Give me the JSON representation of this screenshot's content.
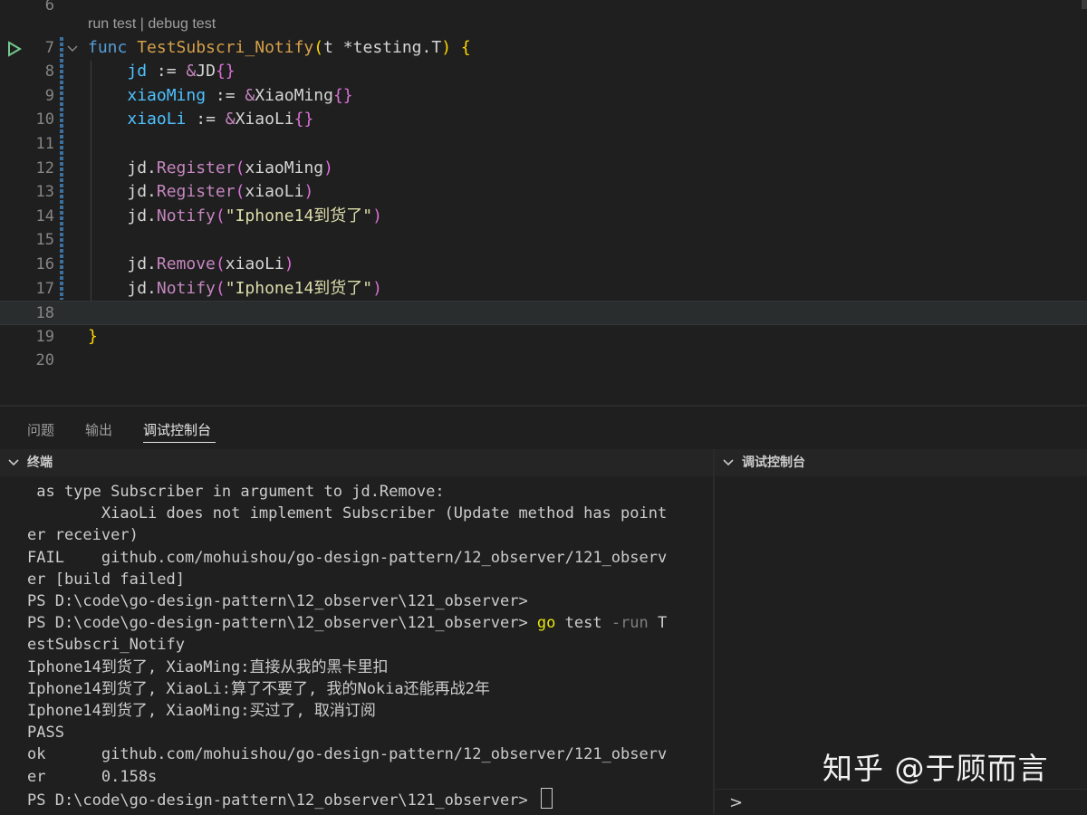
{
  "editor": {
    "codelens": "run test | debug test",
    "line_numbers": [
      "6",
      "7",
      "8",
      "9",
      "10",
      "11",
      "12",
      "13",
      "14",
      "15",
      "16",
      "17",
      "18",
      "19",
      "20"
    ],
    "lines": [
      [],
      [
        [
          "k-kw",
          "func "
        ],
        [
          "k-fn2",
          "TestSubscri_Notify"
        ],
        [
          "k-brace",
          "("
        ],
        [
          "k-plain",
          "t "
        ],
        [
          "k-op",
          "*"
        ],
        [
          "k-plain",
          "testing"
        ],
        [
          "k-plain",
          "."
        ],
        [
          "k-plain",
          "T"
        ],
        [
          "k-brace",
          ")"
        ],
        [
          "k-plain",
          " "
        ],
        [
          "k-brace",
          "{"
        ]
      ],
      [
        [
          "k-plain",
          "    "
        ],
        [
          "k-var",
          "jd"
        ],
        [
          "k-op",
          " := "
        ],
        [
          "k-amp",
          "&"
        ],
        [
          "k-plain",
          "JD"
        ],
        [
          "k-brace2",
          "{}"
        ]
      ],
      [
        [
          "k-plain",
          "    "
        ],
        [
          "k-var",
          "xiaoMing"
        ],
        [
          "k-op",
          " := "
        ],
        [
          "k-amp",
          "&"
        ],
        [
          "k-plain",
          "XiaoMing"
        ],
        [
          "k-brace2",
          "{}"
        ]
      ],
      [
        [
          "k-plain",
          "    "
        ],
        [
          "k-var",
          "xiaoLi"
        ],
        [
          "k-op",
          " := "
        ],
        [
          "k-amp",
          "&"
        ],
        [
          "k-plain",
          "XiaoLi"
        ],
        [
          "k-brace2",
          "{}"
        ]
      ],
      [],
      [
        [
          "k-plain",
          "    "
        ],
        [
          "k-plain",
          "jd."
        ],
        [
          "k-method",
          "Register"
        ],
        [
          "k-paren",
          "("
        ],
        [
          "k-plain",
          "xiaoMing"
        ],
        [
          "k-paren",
          ")"
        ]
      ],
      [
        [
          "k-plain",
          "    "
        ],
        [
          "k-plain",
          "jd."
        ],
        [
          "k-method",
          "Register"
        ],
        [
          "k-paren",
          "("
        ],
        [
          "k-plain",
          "xiaoLi"
        ],
        [
          "k-paren",
          ")"
        ]
      ],
      [
        [
          "k-plain",
          "    "
        ],
        [
          "k-plain",
          "jd."
        ],
        [
          "k-method",
          "Notify"
        ],
        [
          "k-paren",
          "("
        ],
        [
          "k-green",
          "\"Iphone14到货了\""
        ],
        [
          "k-paren",
          ")"
        ]
      ],
      [],
      [
        [
          "k-plain",
          "    "
        ],
        [
          "k-plain",
          "jd."
        ],
        [
          "k-method",
          "Remove"
        ],
        [
          "k-paren",
          "("
        ],
        [
          "k-plain",
          "xiaoLi"
        ],
        [
          "k-paren",
          ")"
        ]
      ],
      [
        [
          "k-plain",
          "    "
        ],
        [
          "k-plain",
          "jd."
        ],
        [
          "k-method",
          "Notify"
        ],
        [
          "k-paren",
          "("
        ],
        [
          "k-green",
          "\"Iphone14到货了\""
        ],
        [
          "k-paren",
          ")"
        ]
      ],
      [],
      [
        [
          "k-brace",
          "}"
        ]
      ],
      []
    ]
  },
  "panel": {
    "tabs": [
      "问题",
      "输出",
      "调试控制台"
    ],
    "terminal_title": "终端",
    "debug_title": "调试控制台",
    "debug_prompt": ">"
  },
  "terminal": {
    "lines": [
      [
        [
          "",
          " as type Subscriber in argument to jd.Remove:"
        ]
      ],
      [
        [
          "",
          "        XiaoLi does not implement Subscriber (Update method has point"
        ]
      ],
      [
        [
          "",
          "er receiver)"
        ]
      ],
      [
        [
          "",
          "FAIL    github.com/mohuishou/go-design-pattern/12_observer/121_observ"
        ]
      ],
      [
        [
          "",
          "er [build failed]"
        ]
      ],
      [
        [
          "",
          "PS D:\\code\\go-design-pattern\\12_observer\\121_observer>"
        ]
      ],
      [
        [
          "",
          "PS D:\\code\\go-design-pattern\\12_observer\\121_observer> "
        ],
        [
          "t-go",
          "go"
        ],
        [
          "",
          " test "
        ],
        [
          "t-flag",
          "-run"
        ],
        [
          "",
          " T"
        ]
      ],
      [
        [
          "",
          "estSubscri_Notify"
        ]
      ],
      [
        [
          "",
          "Iphone14到货了, XiaoMing:直接从我的黑卡里扣"
        ]
      ],
      [
        [
          "",
          "Iphone14到货了, XiaoLi:算了不要了, 我的Nokia还能再战2年"
        ]
      ],
      [
        [
          "",
          "Iphone14到货了, XiaoMing:买过了, 取消订阅"
        ]
      ],
      [
        [
          "",
          "PASS"
        ]
      ],
      [
        [
          "",
          "ok      github.com/mohuishou/go-design-pattern/12_observer/121_observ"
        ]
      ],
      [
        [
          "",
          "er      0.158s"
        ]
      ],
      [
        [
          "",
          "PS D:\\code\\go-design-pattern\\12_observer\\121_observer> "
        ]
      ]
    ]
  },
  "watermark": "知乎 @于顾而言"
}
